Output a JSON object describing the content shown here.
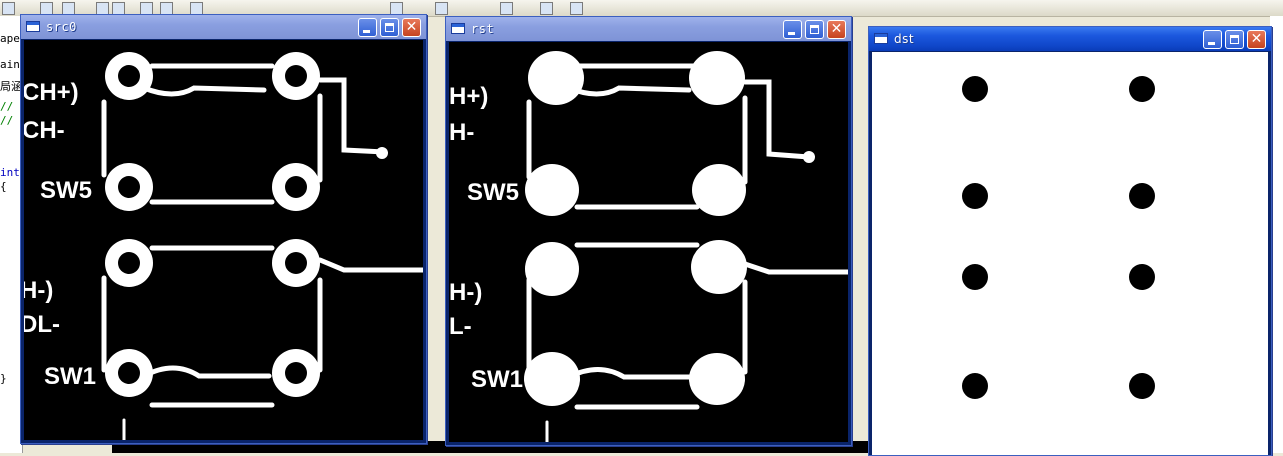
{
  "background_ide": {
    "left_fragments": [
      "ape.",
      "ain",
      "局涵",
      "//",
      "//",
      "int",
      "{",
      "}"
    ],
    "middle_fragment": "ape"
  },
  "windows": {
    "src0": {
      "title": "src0"
    },
    "rst": {
      "title": "rst"
    },
    "dst": {
      "title": "dst"
    }
  },
  "images": {
    "pcb_labels": {
      "ch_plus": "CH+)",
      "ch_minus": "CH-",
      "sw5": "SW5",
      "h_minus": "H-)",
      "dl_minus": "DL-",
      "sw1": "SW1"
    },
    "rst_labels": {
      "ch_plus": "H+)",
      "ch_minus": "H-",
      "sw5": "SW5",
      "h_minus": "H-)",
      "dl_minus": "L-",
      "sw1": "SW1"
    },
    "dst_dot_count": 8
  },
  "colors": {
    "active_title": "#0f46c8",
    "inactive_title": "#8a9fe0",
    "pcb_background": "#000000",
    "pcb_trace": "#ffffff"
  }
}
